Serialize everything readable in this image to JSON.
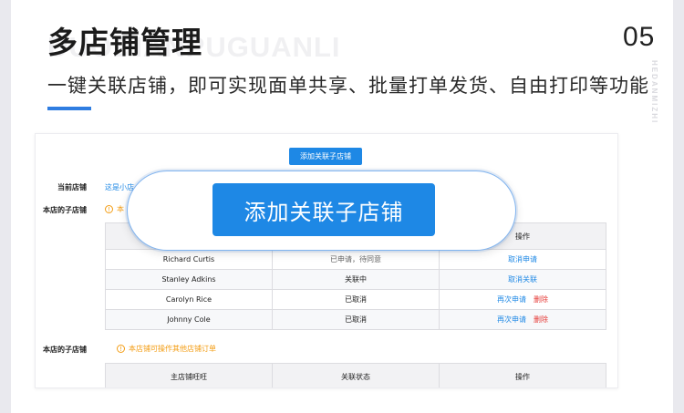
{
  "header": {
    "title": "多店铺管理",
    "watermark": "DUODIANPUGUANLI",
    "subtitle": "一键关联店铺，即可实现面单共享、批量打单发货、自由打印等功能",
    "number": "05",
    "vertical_tag": "HEDANMIZHI"
  },
  "panel": {
    "add_button": "添加关联子店铺",
    "current_store_label": "当前店铺",
    "current_store_value": "这是小店",
    "sub_store_label": "本店的子店铺",
    "tip_partial": "本",
    "table1": {
      "action_header": "操作",
      "rows": [
        {
          "name": "Richard Curtis",
          "status": "已申请，待同意",
          "actions": [
            "取消申请"
          ]
        },
        {
          "name": "Stanley Adkins",
          "status": "关联中",
          "actions": [
            "取消关联"
          ]
        },
        {
          "name": "Carolyn Rice",
          "status": "已取消",
          "actions": [
            "再次申请",
            "删除"
          ]
        },
        {
          "name": "Johnny Cole",
          "status": "已取消",
          "actions": [
            "再次申请",
            "删除"
          ]
        }
      ]
    },
    "sub_store_label2": "本店的子店铺",
    "tip2": "本店铺可操作其他店铺订单",
    "table2": {
      "headers": [
        "主店铺旺旺",
        "关联状态",
        "操作"
      ]
    }
  },
  "zoom": {
    "button": "添加关联子店铺"
  },
  "colors": {
    "accent": "#2f7de1",
    "button": "#1e88e5",
    "warning": "#f39c12",
    "danger": "#e53935"
  }
}
